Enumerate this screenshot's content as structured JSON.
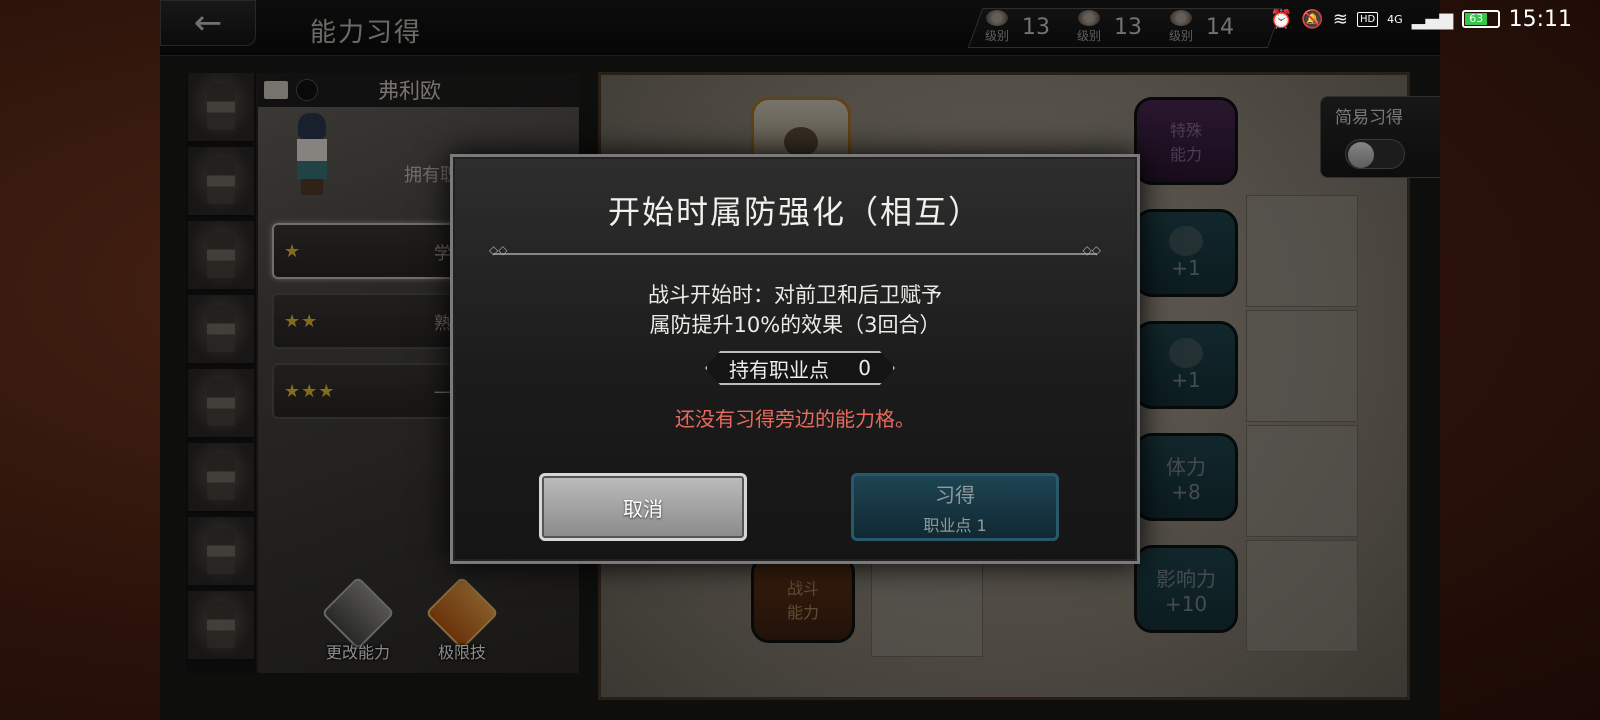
{
  "topbar": {
    "back_icon": "left-arrow-icon",
    "title": "能力习得",
    "levels": [
      {
        "label": "级别",
        "value": "13"
      },
      {
        "label": "级别",
        "value": "13"
      },
      {
        "label": "级别",
        "value": "14"
      }
    ]
  },
  "statusbar": {
    "time": "15:11",
    "battery": "63",
    "network": "4G",
    "hd": "HD"
  },
  "character": {
    "name": "弗利欧",
    "job_points_label": "拥有职业点：",
    "job_points_value": "0",
    "jobs": [
      {
        "stars": "★",
        "name": "学者"
      },
      {
        "stars": "★★",
        "name": "熟练学者"
      },
      {
        "stars": "★★★",
        "name": "一流学者"
      }
    ],
    "buttons": {
      "change_ability": "更改能力",
      "limit_skill": "极限技"
    }
  },
  "board": {
    "easy_learn_label": "简易习得",
    "nodes": {
      "special": "特殊\n能力",
      "plus1": "+1",
      "hp": "体力",
      "hp_value": "+8",
      "influence": "影响力",
      "influence_value": "+10",
      "battle": "战斗\n能力"
    }
  },
  "modal": {
    "title": "开始时属防强化（相互）",
    "description_line1": "战斗开始时：对前卫和后卫赋予",
    "description_line2": "属防提升10%的效果（3回合）",
    "job_points_label": "持有职业点",
    "job_points_value": "0",
    "warning": "还没有习得旁边的能力格。",
    "cancel_label": "取消",
    "learn_label": "习得",
    "learn_cost": "职业点 1"
  },
  "colors": {
    "warning": "#e86a5e",
    "star": "#f0c53a",
    "learn_button": "#1f5467"
  }
}
